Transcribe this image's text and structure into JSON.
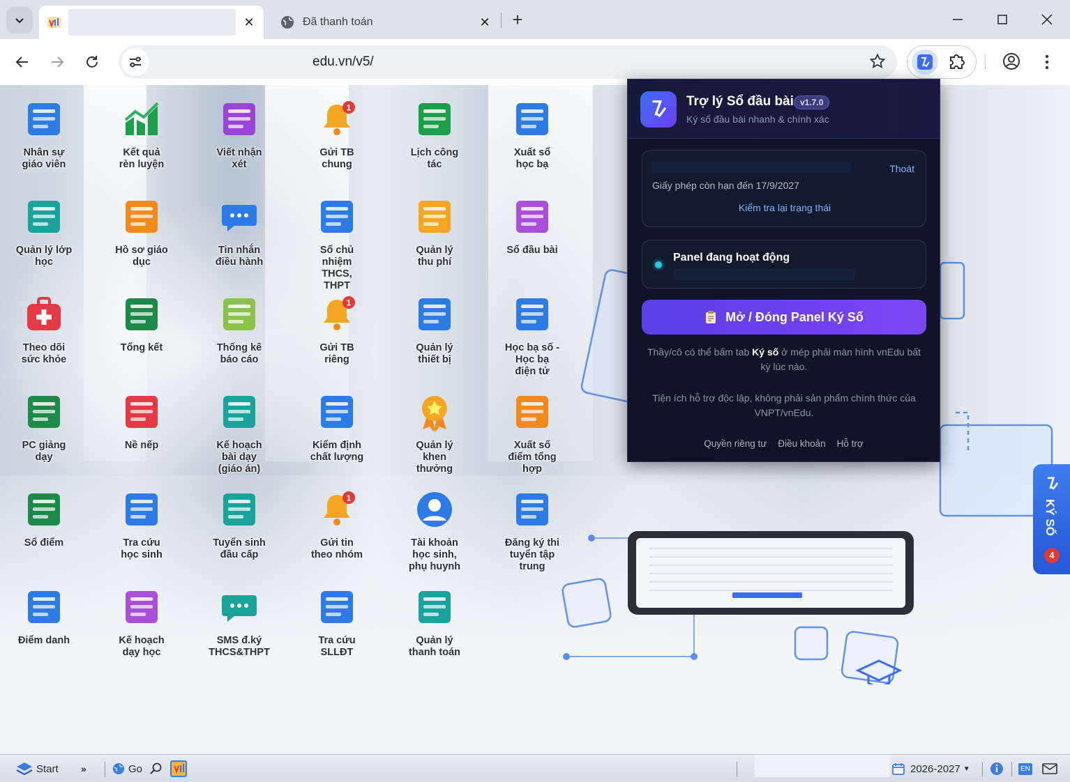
{
  "browser": {
    "tabs": [
      {
        "title": "",
        "active": true
      },
      {
        "title": "Đã thanh toán",
        "active": false
      }
    ],
    "url": "edu.vn/v5/",
    "window_controls": [
      "minimize-icon",
      "maximize-icon",
      "close-icon"
    ]
  },
  "apps": [
    {
      "label": "Nhân sự\ngiáo viên",
      "icon": "staff-id-icon",
      "color": "#2f7be6"
    },
    {
      "label": "Kết quả\nrèn luyện",
      "icon": "growth-chart-icon",
      "color": "#1e9e4a"
    },
    {
      "label": "Viết nhận\nxét",
      "icon": "comment-list-icon",
      "color": "#9b45d8"
    },
    {
      "label": "Gửi TB\nchung",
      "icon": "bell-icon",
      "color": "#f5a623",
      "badge": "1"
    },
    {
      "label": "Lịch công\ntác",
      "icon": "calendar-grid-icon",
      "color": "#1e9e4a"
    },
    {
      "label": "Xuất sổ\nhọc bạ",
      "icon": "export-report-icon",
      "color": "#2f7be6"
    },
    {
      "label": "Quản lý lớp\nhọc",
      "icon": "class-group-icon",
      "color": "#1aa39a"
    },
    {
      "label": "Hồ sơ giáo\ndục",
      "icon": "document-folder-icon",
      "color": "#f08a1c"
    },
    {
      "label": "Tin nhắn\nđiều hành",
      "icon": "chat-bubble-icon",
      "color": "#2f7be6"
    },
    {
      "label": "Sổ chủ\nnhiệm\nTHCS,\nTHPT",
      "icon": "gvcn-book-icon",
      "color": "#2f7be6"
    },
    {
      "label": "Quản lý\nthu phí",
      "icon": "wallet-icon",
      "color": "#f5a623"
    },
    {
      "label": "Sổ đầu bài",
      "icon": "lesson-book-icon",
      "color": "#a94fd8"
    },
    {
      "label": "Theo dõi\nsức khỏe",
      "icon": "first-aid-icon",
      "color": "#e53945"
    },
    {
      "label": "Tổng kết",
      "icon": "hsg-sum-icon",
      "color": "#1e8a4a"
    },
    {
      "label": "Thống kê\nbáo cáo",
      "icon": "clipboard-chart-icon",
      "color": "#8bc34a"
    },
    {
      "label": "Gửi TB\nriêng",
      "icon": "bell-icon",
      "color": "#f5a623",
      "badge": "1"
    },
    {
      "label": "Quản lý\nthiết bị",
      "icon": "globe-lab-icon",
      "color": "#2f7be6"
    },
    {
      "label": "Học bạ số -\nHọc bạ\nđiện tử",
      "icon": "digital-report-icon",
      "color": "#2f7be6"
    },
    {
      "label": "PC giảng\ndạy",
      "icon": "teaching-board-icon",
      "color": "#1e8a4a"
    },
    {
      "label": "Nề nếp",
      "icon": "warning-book-icon",
      "color": "#e53945"
    },
    {
      "label": "Kế hoạch\nbài dạy\n(giáo án)",
      "icon": "lesson-plan-icon",
      "color": "#1aa39a"
    },
    {
      "label": "Kiểm định\nchất lượng",
      "icon": "quality-check-icon",
      "color": "#2f7be6"
    },
    {
      "label": "Quản lý\nkhen\nthưởng",
      "icon": "award-medal-icon",
      "color": "#f5a623"
    },
    {
      "label": "Xuất sổ\nđiểm tổng\nhợp",
      "icon": "export-sum-icon",
      "color": "#f08a1c"
    },
    {
      "label": "Sổ điểm",
      "icon": "gradebook-icon",
      "color": "#1e8a4a"
    },
    {
      "label": "Tra cứu\nhọc sinh",
      "icon": "student-search-icon",
      "color": "#2f7be6"
    },
    {
      "label": "Tuyển sinh\nđầu cấp",
      "icon": "enrollment-icon",
      "color": "#1aa39a"
    },
    {
      "label": "Gửi tin\ntheo nhóm",
      "icon": "bell-icon",
      "color": "#f5a623",
      "badge": "1"
    },
    {
      "label": "Tài khoản\nhọc sinh,\nphụ huynh",
      "icon": "account-user-icon",
      "color": "#2f7be6"
    },
    {
      "label": "Đăng ký thi\ntuyển tập\ntrung",
      "icon": "exam-register-icon",
      "color": "#2f7be6"
    },
    {
      "label": "Điểm danh",
      "icon": "attendance-list-icon",
      "color": "#2f7be6"
    },
    {
      "label": "Kế hoạch\ndạy học",
      "icon": "teaching-calendar-icon",
      "color": "#a94fd8"
    },
    {
      "label": "SMS đ.ký\nTHCS&THPT",
      "icon": "sms-chat-icon",
      "color": "#1aa39a"
    },
    {
      "label": "Tra cứu\nSLLĐT",
      "icon": "contact-search-icon",
      "color": "#2f7be6"
    },
    {
      "label": "Quản lý\nthanh toán",
      "icon": "payment-phone-icon",
      "color": "#1aa39a"
    }
  ],
  "popup": {
    "title": "Trợ lý Sổ đầu bài",
    "version": "v1.7.0",
    "subtitle": "Ký sổ đầu bài nhanh & chính xác",
    "logout": "Thoát",
    "license": "Giấy phép còn hạn đến 17/9/2027",
    "recheck": "Kiểm tra lại trạng thái",
    "status": "Panel đang hoạt động",
    "toggle_button": "Mở / Đóng Panel Ký Số",
    "note1_pre": "Thầy/cô có thể bấm tab ",
    "note1_bold": "Ký số",
    "note1_post": " ở mép phải màn hình vnEdu bất kỳ lúc nào.",
    "note2": "Tiện ích hỗ trợ độc lập, không phải sản phẩm chính thức của VNPT/vnEdu.",
    "links": [
      "Quyền riêng tư",
      "Điều khoản",
      "Hỗ trợ"
    ]
  },
  "side_tab": {
    "label": "KÝ SỐ",
    "badge": "4"
  },
  "taskbar": {
    "start": "Start",
    "go": "Go",
    "school_year": "2026-2027",
    "lang": "EN"
  }
}
